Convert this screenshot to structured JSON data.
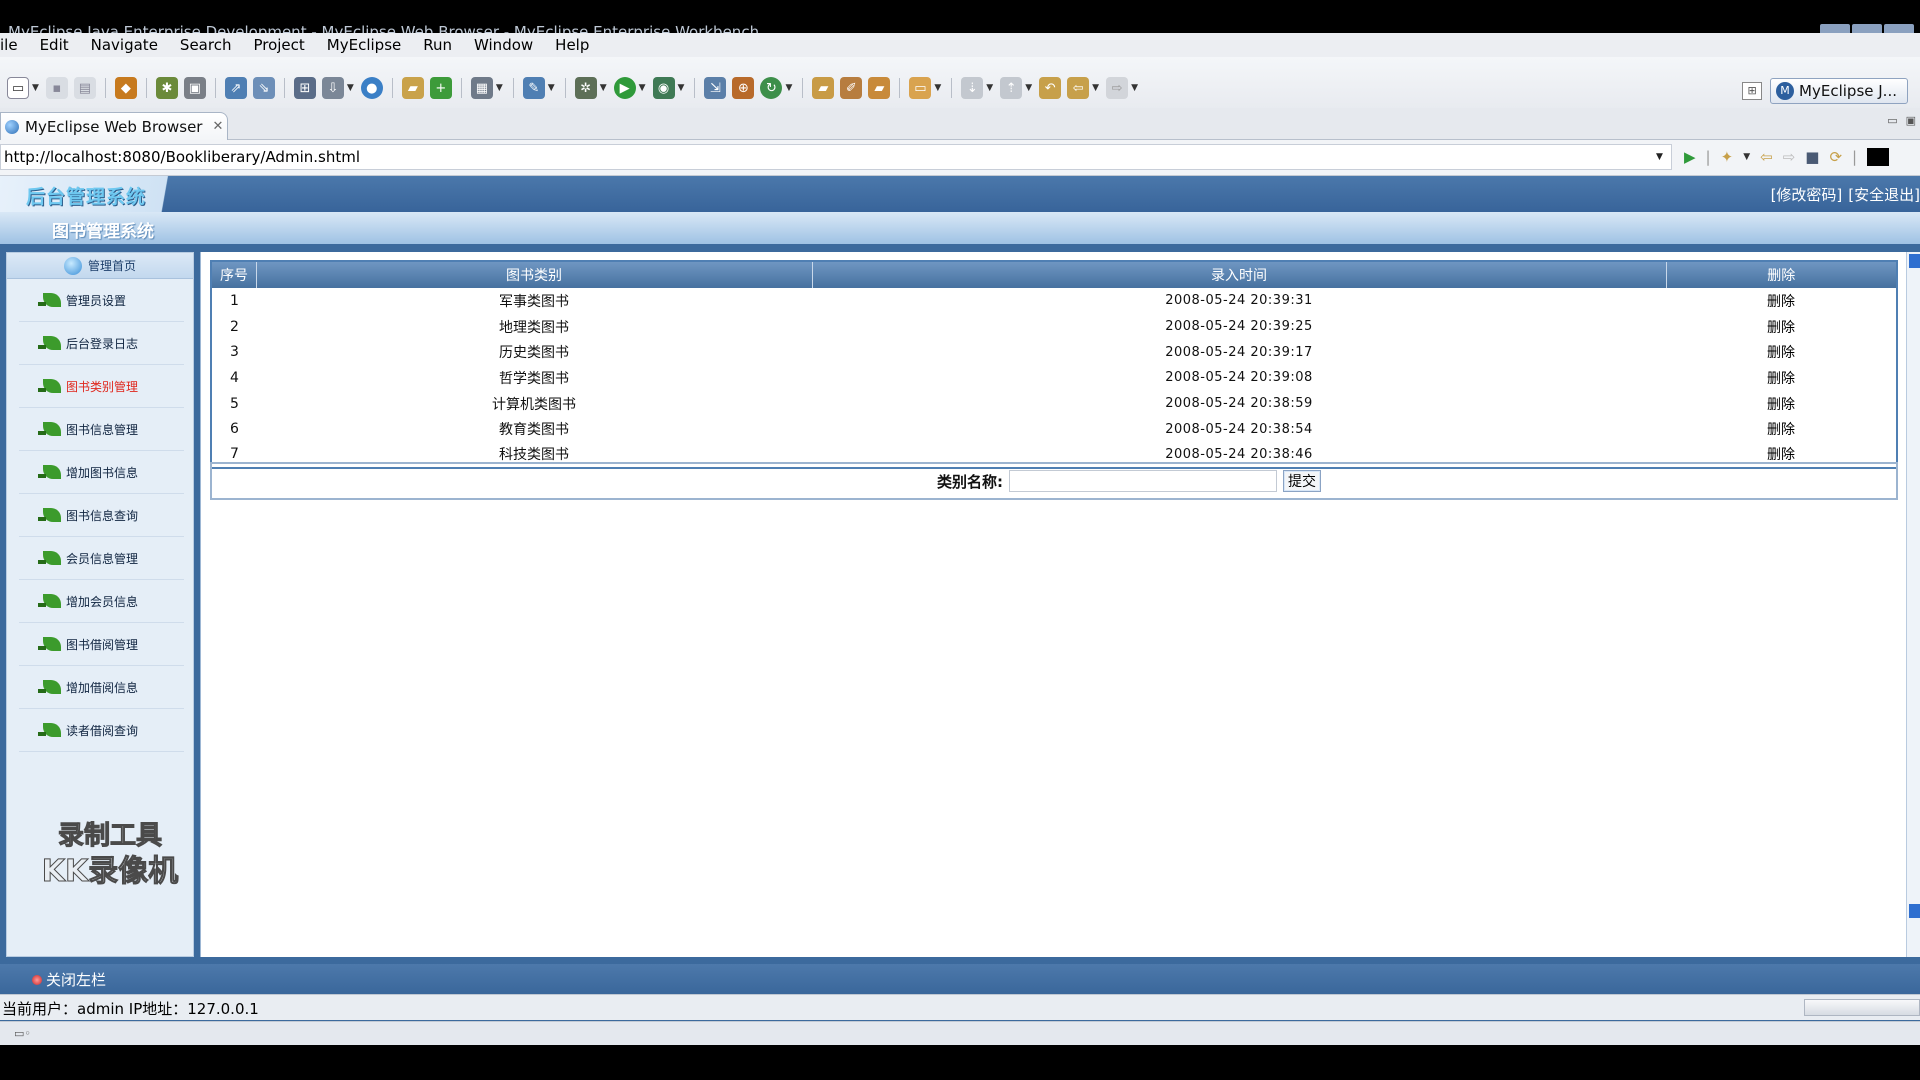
{
  "window": {
    "title": "MyEclipse Java Enterprise Development - MyEclipse Web Browser - MyEclipse Enterprise Workbench"
  },
  "menu": [
    "ile",
    "Edit",
    "Navigate",
    "Search",
    "Project",
    "MyEclipse",
    "Run",
    "Window",
    "Help"
  ],
  "perspective": {
    "label": "MyEclipse J..."
  },
  "tab": {
    "label": "MyEclipse Web Browser",
    "close": "✕"
  },
  "address": {
    "url": "http://localhost:8080/Bookliberary/Admin.shtml"
  },
  "app": {
    "logo": "后台管理系统",
    "top_links": [
      "[修改密码]",
      "[安全退出]"
    ],
    "subtitle": "图书管理系统",
    "nav_home": "管理首页",
    "nav_items": [
      {
        "label": "管理员设置",
        "active": false
      },
      {
        "label": "后台登录日志",
        "active": false
      },
      {
        "label": "图书类别管理",
        "active": true
      },
      {
        "label": "图书信息管理",
        "active": false
      },
      {
        "label": "增加图书信息",
        "active": false
      },
      {
        "label": "图书信息查询",
        "active": false
      },
      {
        "label": "会员信息管理",
        "active": false
      },
      {
        "label": "增加会员信息",
        "active": false
      },
      {
        "label": "图书借阅管理",
        "active": false
      },
      {
        "label": "增加借阅信息",
        "active": false
      },
      {
        "label": "读者借阅查询",
        "active": false
      }
    ],
    "watermark": [
      "录制工具",
      "KK录像机"
    ],
    "table": {
      "headers": [
        "序号",
        "图书类别",
        "录入时间",
        "删除"
      ],
      "rows": [
        {
          "id": "1",
          "category": "军事类图书",
          "time": "2008-05-24 20:39:31",
          "del": "删除"
        },
        {
          "id": "2",
          "category": "地理类图书",
          "time": "2008-05-24 20:39:25",
          "del": "删除"
        },
        {
          "id": "3",
          "category": "历史类图书",
          "time": "2008-05-24 20:39:17",
          "del": "删除"
        },
        {
          "id": "4",
          "category": "哲学类图书",
          "time": "2008-05-24 20:39:08",
          "del": "删除"
        },
        {
          "id": "5",
          "category": "计算机类图书",
          "time": "2008-05-24 20:38:59",
          "del": "删除"
        },
        {
          "id": "6",
          "category": "教育类图书",
          "time": "2008-05-24 20:38:54",
          "del": "删除"
        },
        {
          "id": "7",
          "category": "科技类图书",
          "time": "2008-05-24 20:38:46",
          "del": "删除"
        }
      ]
    },
    "form": {
      "label": "类别名称:",
      "value": "",
      "submit": "提交"
    },
    "footer": {
      "close_sidebar": "关闭左栏"
    },
    "status": {
      "text": "当前用户：admin  IP地址：127.0.0.1"
    }
  },
  "colors": {
    "header_blue": "#3c6a9d",
    "table_header": "#5a84b3",
    "active_nav": "#e0261c",
    "nav_bg": "#e5eef7"
  }
}
